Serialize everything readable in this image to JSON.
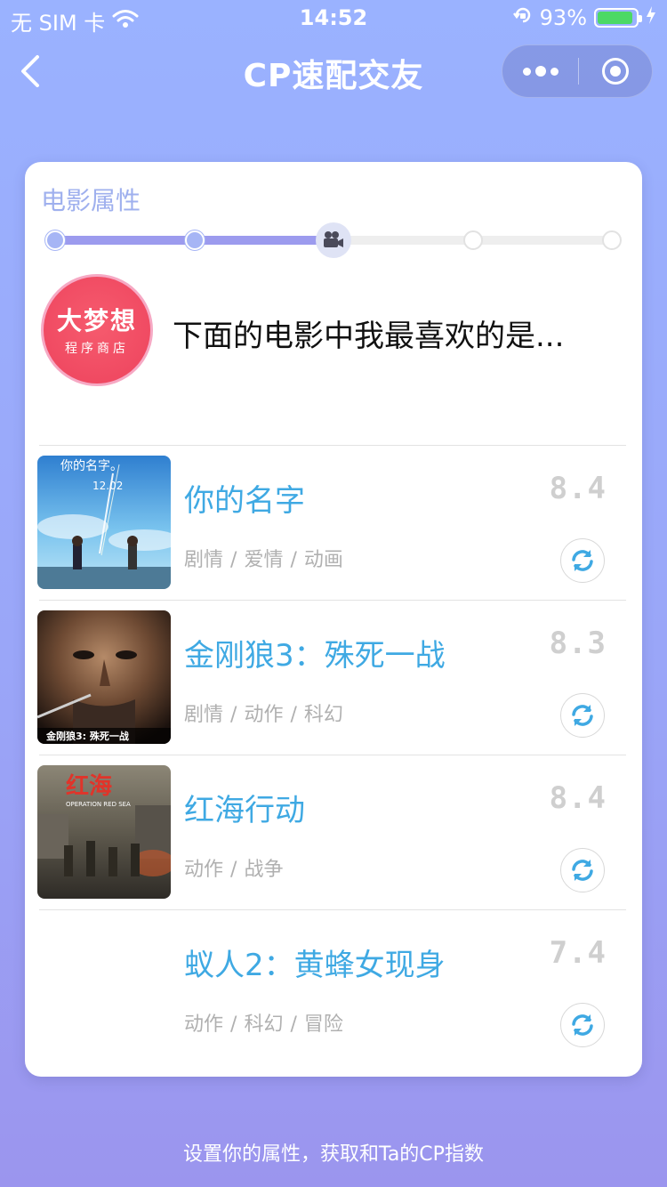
{
  "status_bar": {
    "carrier": "无 SIM 卡",
    "time": "14:52",
    "battery": "93%",
    "battery_level": 0.93
  },
  "nav": {
    "title": "CP速配交友"
  },
  "card": {
    "label": "电影属性",
    "progress": {
      "total_steps": 5,
      "current_step": 3
    },
    "avatar": {
      "title": "大梦想",
      "subtitle": "程序商店"
    },
    "question": "下面的电影中我最喜欢的是..."
  },
  "movies": [
    {
      "title": "你的名字",
      "score": "8.4",
      "tags": [
        "剧情",
        "爱情",
        "动画"
      ]
    },
    {
      "title": "金刚狼3：殊死一战",
      "score": "8.3",
      "tags": [
        "剧情",
        "动作",
        "科幻"
      ]
    },
    {
      "title": "红海行动",
      "score": "8.4",
      "tags": [
        "动作",
        "战争"
      ]
    },
    {
      "title": "蚁人2：黄蜂女现身",
      "score": "7.4",
      "tags": [
        "动作",
        "科幻",
        "冒险"
      ]
    }
  ],
  "posters": {
    "0": {
      "overlay_title": "你的名字。",
      "overlay_date": "12.02"
    },
    "1": {
      "overlay_title": "金刚狼3: 殊死一战"
    },
    "2": {
      "overlay_title": "红海",
      "overlay_sub": "OPERATION RED SEA"
    }
  },
  "footer": "设置你的属性，获取和Ta的CP指数",
  "colors": {
    "accent": "#3fa9e3",
    "progress": "#9c9bee",
    "label": "#9fb0ee",
    "score": "#cfcfcf",
    "tag": "#b0b0b0"
  }
}
